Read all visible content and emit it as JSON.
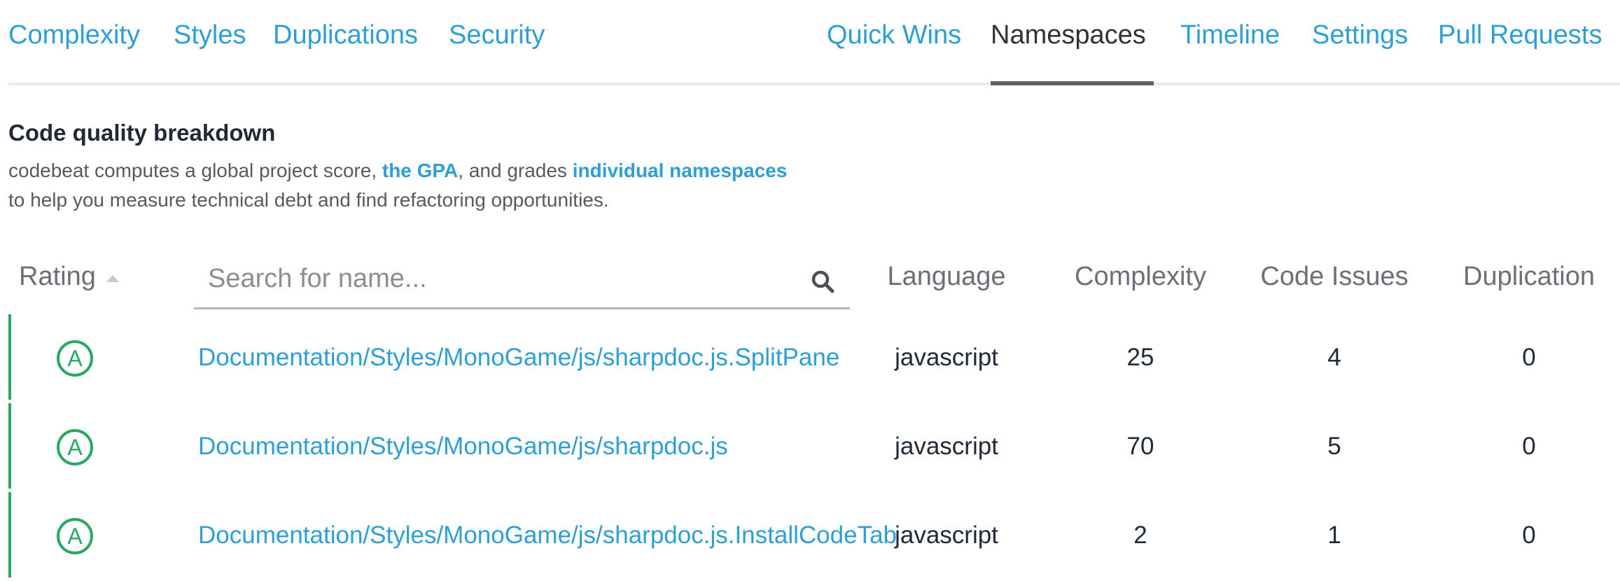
{
  "nav": {
    "tabs": [
      {
        "label": "Complexity"
      },
      {
        "label": "Styles"
      },
      {
        "label": "Duplications"
      },
      {
        "label": "Security"
      },
      {
        "label": "Quick Wins"
      },
      {
        "label": "Namespaces",
        "active": true
      },
      {
        "label": "Timeline"
      },
      {
        "label": "Settings"
      },
      {
        "label": "Pull Requests"
      }
    ]
  },
  "intro": {
    "heading": "Code quality breakdown",
    "line1_prefix": "codebeat computes a global project score, ",
    "gpa_link": "the GPA",
    "line1_middle": ", and grades ",
    "namespaces_link": "individual namespaces",
    "line2": "to help you measure technical debt and find refactoring opportunities."
  },
  "table": {
    "columns": {
      "rating": "Rating",
      "language": "Language",
      "complexity": "Complexity",
      "code_issues": "Code Issues",
      "duplication": "Duplication"
    },
    "search": {
      "placeholder": "Search for name...",
      "value": ""
    },
    "rows": [
      {
        "grade": "A",
        "name": "Documentation/Styles/MonoGame/js/sharpdoc.js.SplitPane",
        "language": "javascript",
        "complexity": "25",
        "code_issues": "4",
        "duplication": "0"
      },
      {
        "grade": "A",
        "name": "Documentation/Styles/MonoGame/js/sharpdoc.js",
        "language": "javascript",
        "complexity": "70",
        "code_issues": "5",
        "duplication": "0"
      },
      {
        "grade": "A",
        "name": "Documentation/Styles/MonoGame/js/sharpdoc.js.InstallCodeTab",
        "language": "javascript",
        "complexity": "2",
        "code_issues": "1",
        "duplication": "0"
      }
    ]
  },
  "colors": {
    "link": "#2e9fd6",
    "grade_a": "#2aa760",
    "active_tab": "#2e3338"
  },
  "icons": {
    "search": "search-icon",
    "sort": "sort-ascending-icon"
  }
}
